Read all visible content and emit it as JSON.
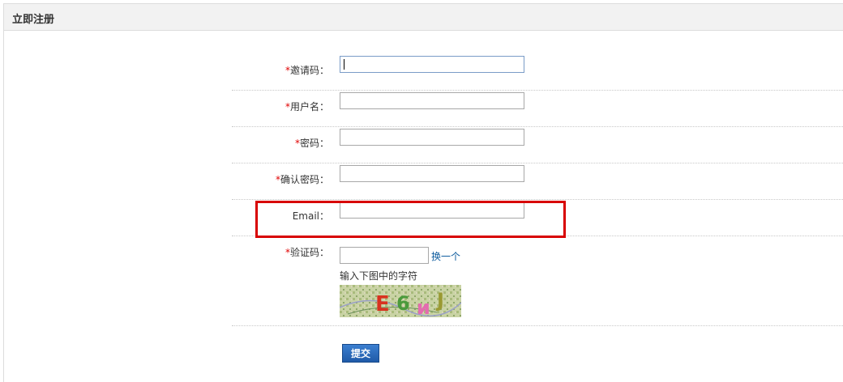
{
  "panel": {
    "title": "立即注册"
  },
  "form": {
    "fields": [
      {
        "required": "*",
        "label": "邀请码：",
        "value": ""
      },
      {
        "required": "*",
        "label": "用户名：",
        "value": ""
      },
      {
        "required": "*",
        "label": "密码：",
        "value": ""
      },
      {
        "required": "*",
        "label": "确认密码：",
        "value": ""
      },
      {
        "required": "",
        "label": "Email：",
        "value": ""
      }
    ],
    "captcha": {
      "required": "*",
      "label": "验证码：",
      "value": "",
      "refresh_label": "换一个",
      "hint": "输入下图中的字符",
      "image_text": "E6иJ"
    },
    "submit_label": "提交"
  },
  "colors": {
    "required_mark": "#e00000",
    "highlight_border": "#d80000",
    "link": "#0d5b9e",
    "button": "#1f5aa8"
  }
}
